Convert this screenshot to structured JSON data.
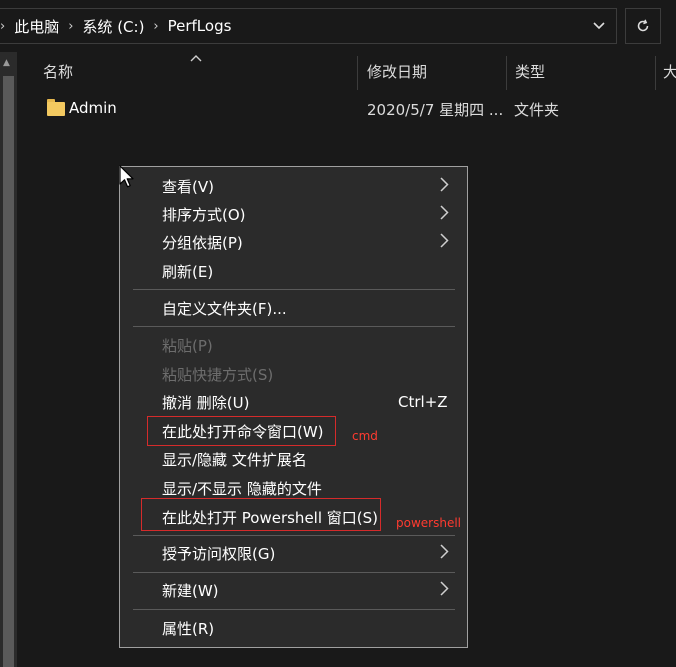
{
  "breadcrumb": {
    "items": [
      "此电脑",
      "系统 (C:)",
      "PerfLogs"
    ]
  },
  "icons": {
    "dropdown": "chevron-down-icon",
    "refresh": "refresh-icon",
    "sort": "sort-ascending-icon",
    "folder": "folder-icon",
    "submenu": "chevron-right-icon",
    "cursor": "mouse-pointer-icon"
  },
  "columns": {
    "name": "名称",
    "modified": "修改日期",
    "type": "类型",
    "size": "大"
  },
  "files": [
    {
      "name": "Admin",
      "modified": "2020/5/7 星期四 ...",
      "type": "文件夹"
    }
  ],
  "context_menu": {
    "view": "查看(V)",
    "sort_by": "排序方式(O)",
    "group_by": "分组依据(P)",
    "refresh": "刷新(E)",
    "customize_folder": "自定义文件夹(F)...",
    "paste": "粘贴(P)",
    "paste_shortcut": "粘贴快捷方式(S)",
    "undo_delete": "撤消 删除(U)",
    "undo_shortcut": "Ctrl+Z",
    "open_cmd": "在此处打开命令窗口(W)",
    "show_hide_ext": "显示/隐藏 文件扩展名",
    "show_hidden": "显示/不显示 隐藏的文件",
    "open_powershell": "在此处打开 Powershell 窗口(S)",
    "give_access": "授予访问权限(G)",
    "new": "新建(W)",
    "properties": "属性(R)"
  },
  "annotations": {
    "cmd": "cmd",
    "powershell": "powershell"
  },
  "colors": {
    "annotation_red": "#d52b2b",
    "background": "#191919",
    "menu_background": "#2b2b2b"
  }
}
